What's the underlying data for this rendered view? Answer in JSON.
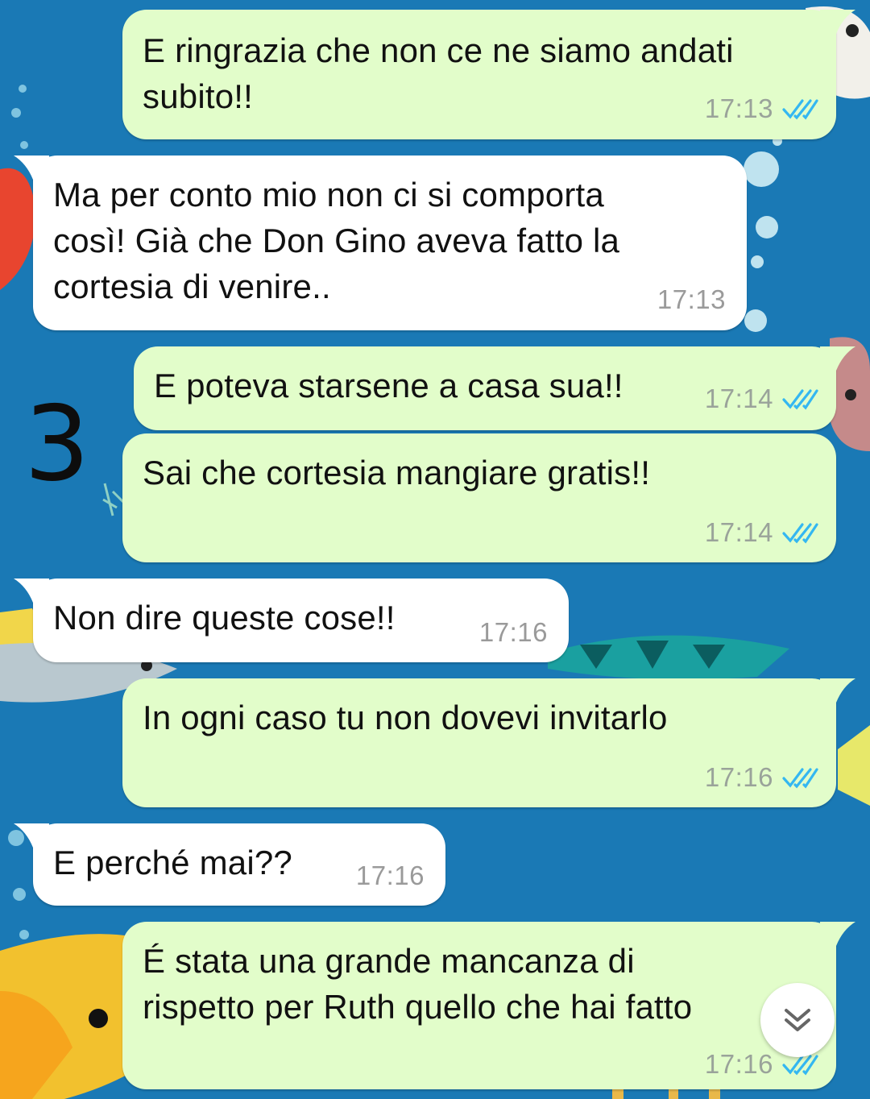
{
  "colors": {
    "wallpaper": "#1a79b5",
    "outgoing_bubble": "#e2fdca",
    "incoming_bubble": "#ffffff",
    "read_ticks": "#34b7f1"
  },
  "annotation": "3",
  "messages": [
    {
      "direction": "out",
      "text": "E ringrazia che non ce ne siamo andati\nsubito!!",
      "time": "17:13",
      "status": "read"
    },
    {
      "direction": "in",
      "text": "Ma per conto mio non ci si comporta\ncosì! Già che Don Gino aveva fatto la\ncortesia di venire..",
      "time": "17:13"
    },
    {
      "direction": "out",
      "text": "E poteva starsene a casa sua!!",
      "time": "17:14",
      "status": "read"
    },
    {
      "direction": "out",
      "text": "Sai che cortesia mangiare gratis!!",
      "time": "17:14",
      "status": "read"
    },
    {
      "direction": "in",
      "text": "Non dire queste cose!!",
      "time": "17:16"
    },
    {
      "direction": "out",
      "text": "In ogni caso tu non dovevi invitarlo",
      "time": "17:16",
      "status": "read"
    },
    {
      "direction": "in",
      "text": "E perché mai??",
      "time": "17:16"
    },
    {
      "direction": "out",
      "text": "É stata una grande mancanza di\nrispetto per Ruth quello che hai fatto",
      "time": "17:16",
      "status": "read"
    }
  ],
  "icons": {
    "read_receipt": "double-check-icon",
    "scroll_to_bottom": "chevron-double-down-icon"
  }
}
